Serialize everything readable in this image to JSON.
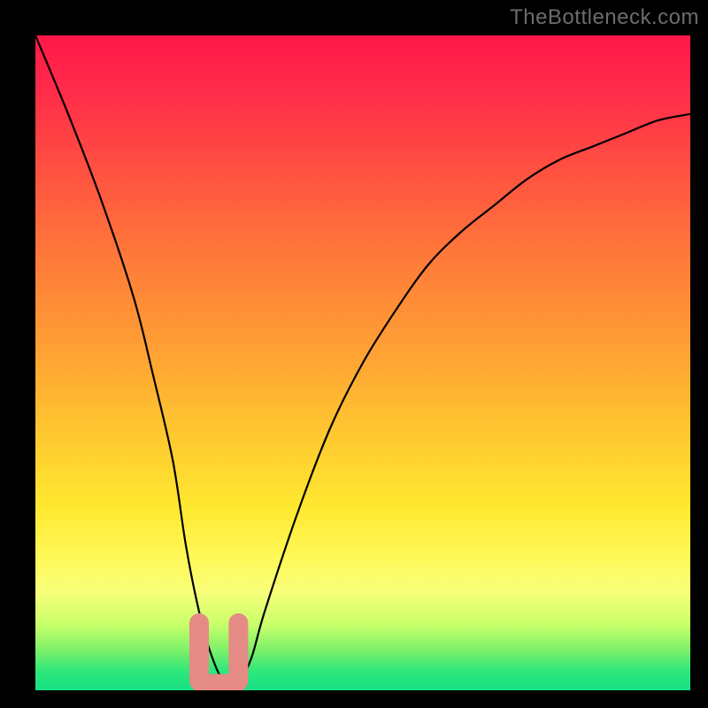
{
  "watermark": "TheBottleneck.com",
  "chart_data": {
    "type": "line",
    "title": "",
    "xlabel": "",
    "ylabel": "",
    "xlim": [
      0,
      100
    ],
    "ylim": [
      0,
      100
    ],
    "series": [
      {
        "name": "bottleneck-curve",
        "x": [
          0,
          5,
          10,
          15,
          18,
          21,
          23,
          25,
          27,
          29,
          31,
          33,
          35,
          40,
          45,
          50,
          55,
          60,
          65,
          70,
          75,
          80,
          85,
          90,
          95,
          100
        ],
        "values": [
          100,
          88,
          75,
          60,
          48,
          35,
          22,
          12,
          5,
          1,
          1,
          5,
          12,
          27,
          40,
          50,
          58,
          65,
          70,
          74,
          78,
          81,
          83,
          85,
          87,
          88
        ]
      }
    ],
    "annotations": [
      {
        "name": "valley-marker",
        "x_range": [
          25,
          31
        ],
        "y": 1
      }
    ],
    "background_gradient": {
      "top": "#ff1847",
      "mid": "#ffe830",
      "bottom": "#17e085"
    }
  }
}
